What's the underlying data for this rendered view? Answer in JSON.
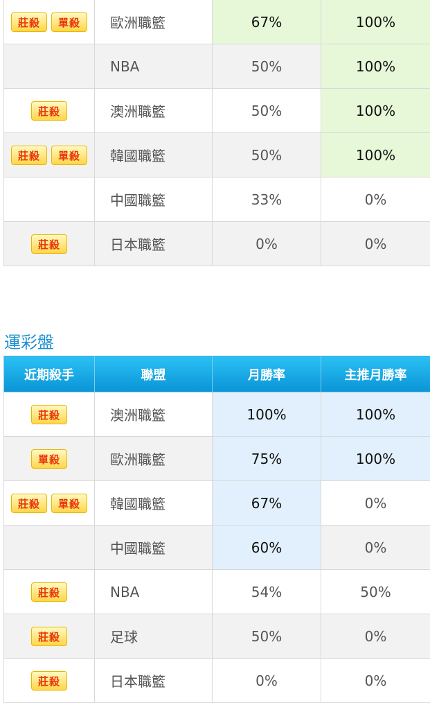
{
  "colors": {
    "accent": "#1a8fd0",
    "highlight_green": "#e6f8d8",
    "highlight_blue": "#e1f0fc",
    "badge_text": "#e8360c"
  },
  "table1": {
    "rows": [
      {
        "badges": [
          "莊殺",
          "單殺"
        ],
        "league": "歐洲職籃",
        "monthly": "67%",
        "main": "100%",
        "monthly_hl": true,
        "main_hl": true
      },
      {
        "badges": [],
        "league": "NBA",
        "monthly": "50%",
        "main": "100%",
        "monthly_hl": false,
        "main_hl": true
      },
      {
        "badges": [
          "莊殺"
        ],
        "league": "澳洲職籃",
        "monthly": "50%",
        "main": "100%",
        "monthly_hl": false,
        "main_hl": true
      },
      {
        "badges": [
          "莊殺",
          "單殺"
        ],
        "league": "韓國職籃",
        "monthly": "50%",
        "main": "100%",
        "monthly_hl": false,
        "main_hl": true
      },
      {
        "badges": [],
        "league": "中國職籃",
        "monthly": "33%",
        "main": "0%",
        "monthly_hl": false,
        "main_hl": false
      },
      {
        "badges": [
          "莊殺"
        ],
        "league": "日本職籃",
        "monthly": "0%",
        "main": "0%",
        "monthly_hl": false,
        "main_hl": false
      }
    ]
  },
  "section2": {
    "title": "運彩盤",
    "headers": [
      "近期殺手",
      "聯盟",
      "月勝率",
      "主推月勝率"
    ],
    "rows": [
      {
        "badges": [
          "莊殺"
        ],
        "league": "澳洲職籃",
        "monthly": "100%",
        "main": "100%",
        "monthly_hl": true,
        "main_hl": true
      },
      {
        "badges": [
          "單殺"
        ],
        "league": "歐洲職籃",
        "monthly": "75%",
        "main": "100%",
        "monthly_hl": true,
        "main_hl": true
      },
      {
        "badges": [
          "莊殺",
          "單殺"
        ],
        "league": "韓國職籃",
        "monthly": "67%",
        "main": "0%",
        "monthly_hl": true,
        "main_hl": false
      },
      {
        "badges": [],
        "league": "中國職籃",
        "monthly": "60%",
        "main": "0%",
        "monthly_hl": true,
        "main_hl": false
      },
      {
        "badges": [
          "莊殺"
        ],
        "league": "NBA",
        "monthly": "54%",
        "main": "50%",
        "monthly_hl": false,
        "main_hl": false
      },
      {
        "badges": [
          "莊殺"
        ],
        "league": "足球",
        "monthly": "50%",
        "main": "0%",
        "monthly_hl": false,
        "main_hl": false
      },
      {
        "badges": [
          "莊殺"
        ],
        "league": "日本職籃",
        "monthly": "0%",
        "main": "0%",
        "monthly_hl": false,
        "main_hl": false
      }
    ]
  }
}
